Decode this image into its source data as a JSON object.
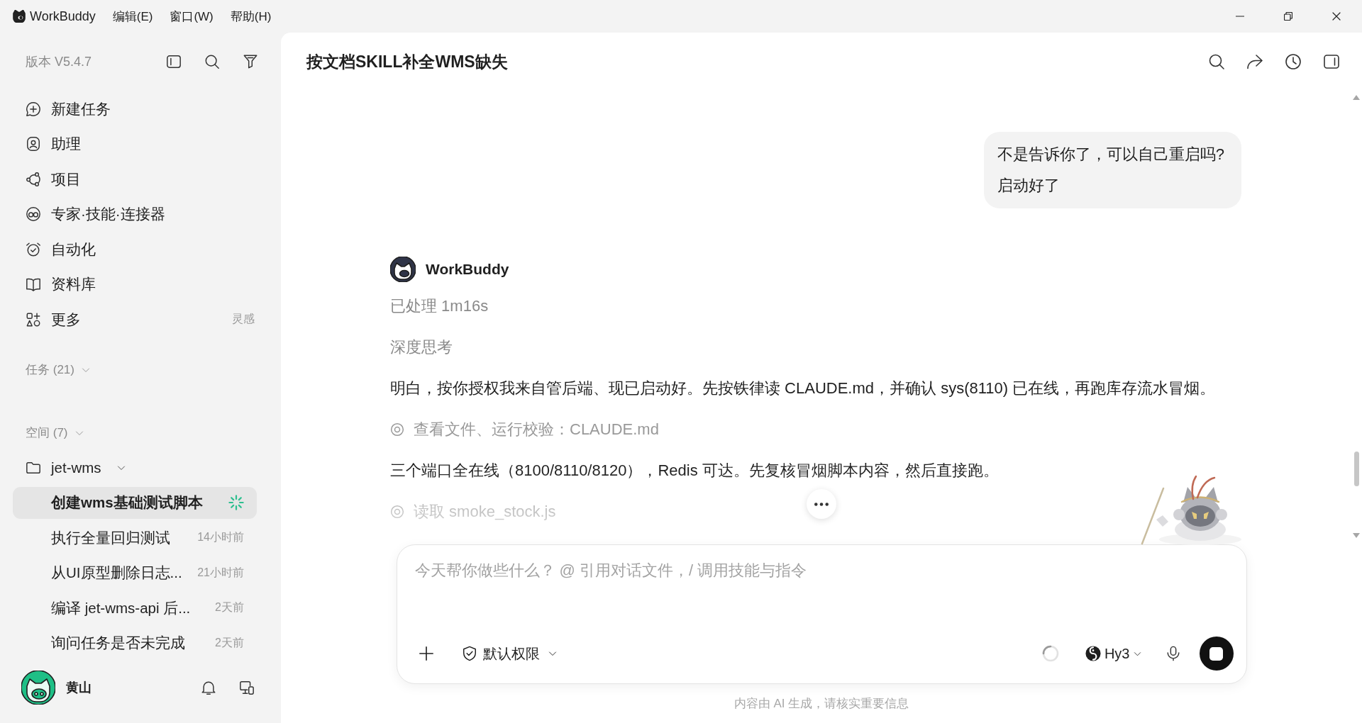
{
  "titlebar": {
    "app_name": "WorkBuddy",
    "menus": [
      "编辑(E)",
      "窗口(W)",
      "帮助(H)"
    ]
  },
  "sidebar": {
    "version": "版本 V5.4.7",
    "nav": [
      {
        "label": "新建任务",
        "selected": false
      },
      {
        "label": "助理",
        "selected": false
      },
      {
        "label": "项目",
        "selected": false
      },
      {
        "label": "专家·技能·连接器",
        "selected": false
      },
      {
        "label": "自动化",
        "selected": false
      },
      {
        "label": "资料库",
        "selected": false
      },
      {
        "label": "更多",
        "hint": "灵感",
        "selected": false
      }
    ],
    "tasks_section": {
      "label": "任务 (21)",
      "expanded": true
    },
    "spaces_section": {
      "label": "空间 (7)",
      "expanded": true,
      "spaces": [
        {
          "name": "jet-wms",
          "expanded": true,
          "tasks": [
            {
              "title": "创建wms基础测试脚本",
              "selected": true,
              "running": true
            },
            {
              "title": "执行全量回归测试",
              "time": "14小时前",
              "selected": false,
              "running": false
            },
            {
              "title": "从UI原型删除日志...",
              "time": "21小时前",
              "selected": false,
              "running": false
            },
            {
              "title": "编译 jet-wms-api 后...",
              "time": "2天前",
              "selected": false,
              "running": false
            },
            {
              "title": "询问任务是否未完成",
              "time": "2天前",
              "selected": false,
              "running": false
            }
          ]
        }
      ]
    },
    "user": {
      "name": "黄山"
    }
  },
  "chat": {
    "title": "按文档SKILL补全WMS缺失",
    "messages": [
      {
        "kind": "user",
        "lines": [
          "不是告诉你了，可以自己重启吗?",
          "启动好了"
        ]
      },
      {
        "kind": "assistant",
        "author": "WorkBuddy",
        "status": "已处理 1m16s",
        "blocks": [
          {
            "kind": "thinking",
            "text": "深度思考"
          },
          {
            "kind": "text",
            "text": "明白，按你授权我来自管后端、现已启动好。先按铁律读 CLAUDE.md，并确认 sys(8110) 已在线，再跑库存流水冒烟。"
          },
          {
            "kind": "tool",
            "text": "查看文件、运行校验：CLAUDE.md"
          },
          {
            "kind": "text",
            "text": "三个端口全在线（8100/8110/8120），Redis 可达。先复核冒烟脚本内容，然后直接跑。"
          },
          {
            "kind": "tool",
            "text": "读取 smoke_stock.js"
          }
        ]
      }
    ]
  },
  "composer": {
    "placeholder": "今天帮你做些什么？ @ 引用对话文件，/ 调用技能与指令",
    "permission": "默认权限",
    "model": "Hy3",
    "generating": true
  },
  "disclaimer": "内容由 AI 生成，请核实重要信息"
}
